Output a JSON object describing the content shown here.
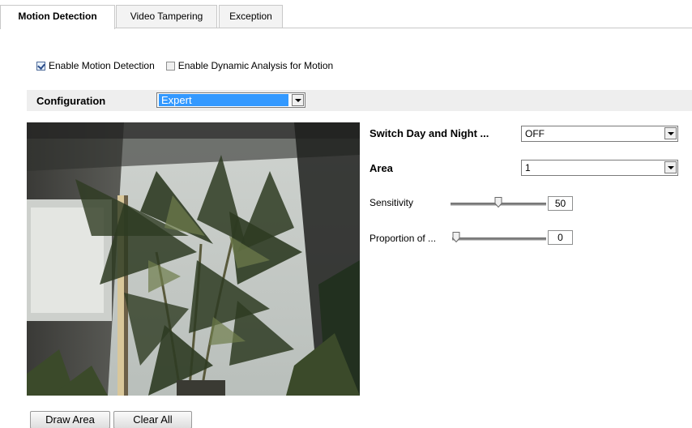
{
  "tabs": [
    {
      "label": "Motion Detection",
      "active": true
    },
    {
      "label": "Video Tampering",
      "active": false
    },
    {
      "label": "Exception",
      "active": false
    }
  ],
  "options": {
    "enable_motion_detection": {
      "label": "Enable Motion Detection",
      "checked": true
    },
    "enable_dynamic_analysis": {
      "label": "Enable Dynamic Analysis for Motion",
      "checked": false
    }
  },
  "configuration": {
    "label": "Configuration",
    "value": "Expert"
  },
  "settings": {
    "switch_day_night": {
      "label": "Switch Day and Night ...",
      "value": "OFF"
    },
    "area": {
      "label": "Area",
      "value": "1"
    },
    "sensitivity": {
      "label": "Sensitivity",
      "value": "50",
      "fraction": 0.5
    },
    "proportion": {
      "label": "Proportion of ...",
      "value": "0",
      "fraction": 0.0
    }
  },
  "buttons": {
    "draw_area": "Draw Area",
    "clear_all": "Clear All"
  },
  "colors": {
    "selection": "#3399ff",
    "config_bar": "#eeeeee"
  }
}
